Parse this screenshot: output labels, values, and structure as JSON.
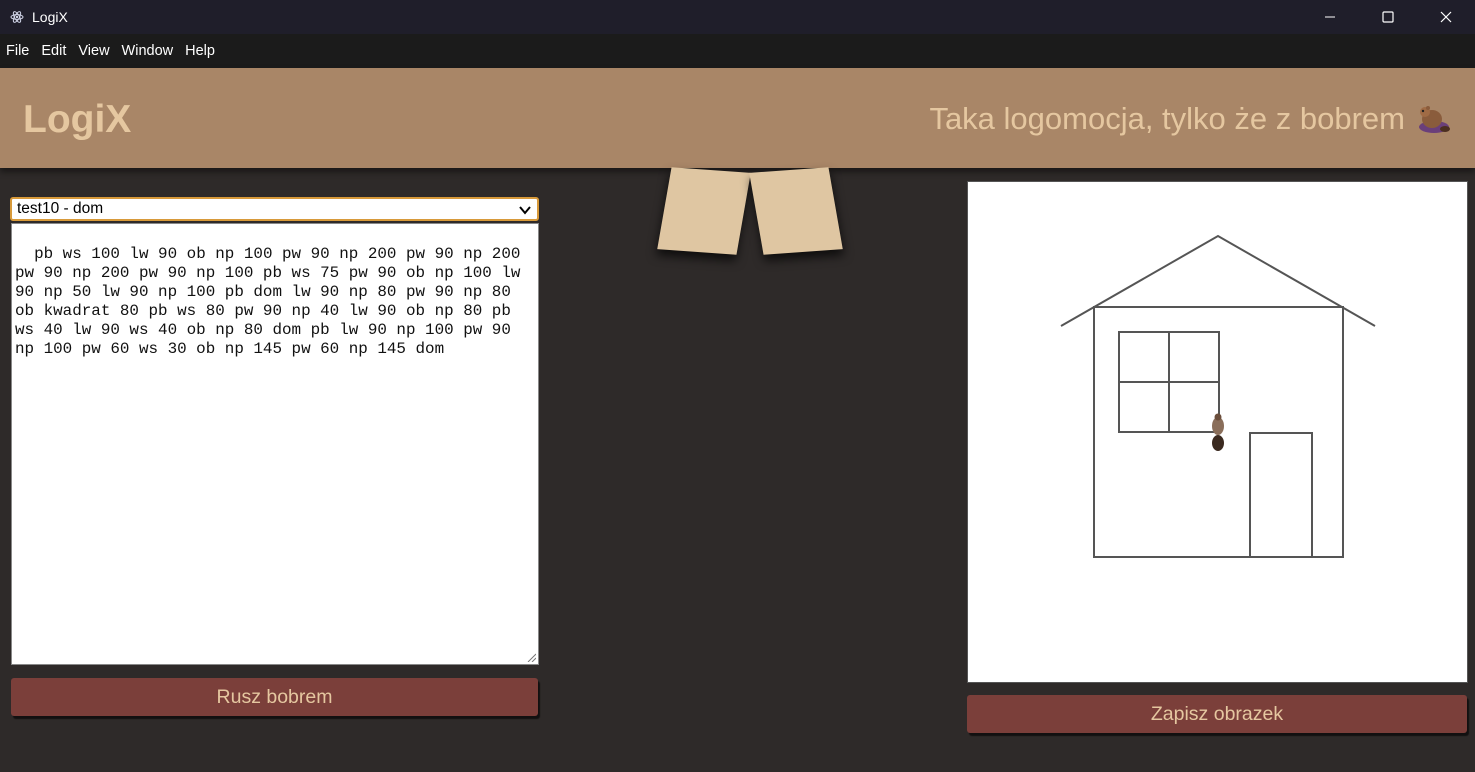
{
  "window": {
    "title": "LogiX",
    "icons": [
      "atom-icon",
      "minimize-icon",
      "maximize-icon",
      "close-icon"
    ]
  },
  "menu": [
    "File",
    "Edit",
    "View",
    "Window",
    "Help"
  ],
  "header": {
    "logo": "LogiX",
    "tagline": "Taka logomocja, tylko że z bobrem",
    "tagline_icon": "beaver-icon"
  },
  "editor": {
    "selected_test": "test10 - dom",
    "code": "pb ws 100 lw 90 ob np 100 pw 90 np 200 pw 90 np 200 pw 90 np 200 pw 90 np 100 pb ws 75 pw 90 ob np 100 lw 90 np 50 lw 90 np 100 pb dom lw 90 np 80 pw 90 np 80 ob kwadrat 80 pb ws 80 pw 90 np 40 lw 90 ob np 80 pb ws 40 lw 90 ws 40 ob np 80 dom pb lw 90 np 100 pw 90 np 100 pw 60 ws 30 ob np 145 pw 60 np 145 dom",
    "run_label": "Rusz bobrem"
  },
  "canvas": {
    "save_label": "Zapisz obrazek",
    "turtle_icon": "beaver-icon"
  },
  "colors": {
    "background": "#2e2a29",
    "header": "#a98667",
    "accent_text": "#e5c7a0",
    "button": "#7b3f3a",
    "ribbon": "#dfc6a2"
  }
}
